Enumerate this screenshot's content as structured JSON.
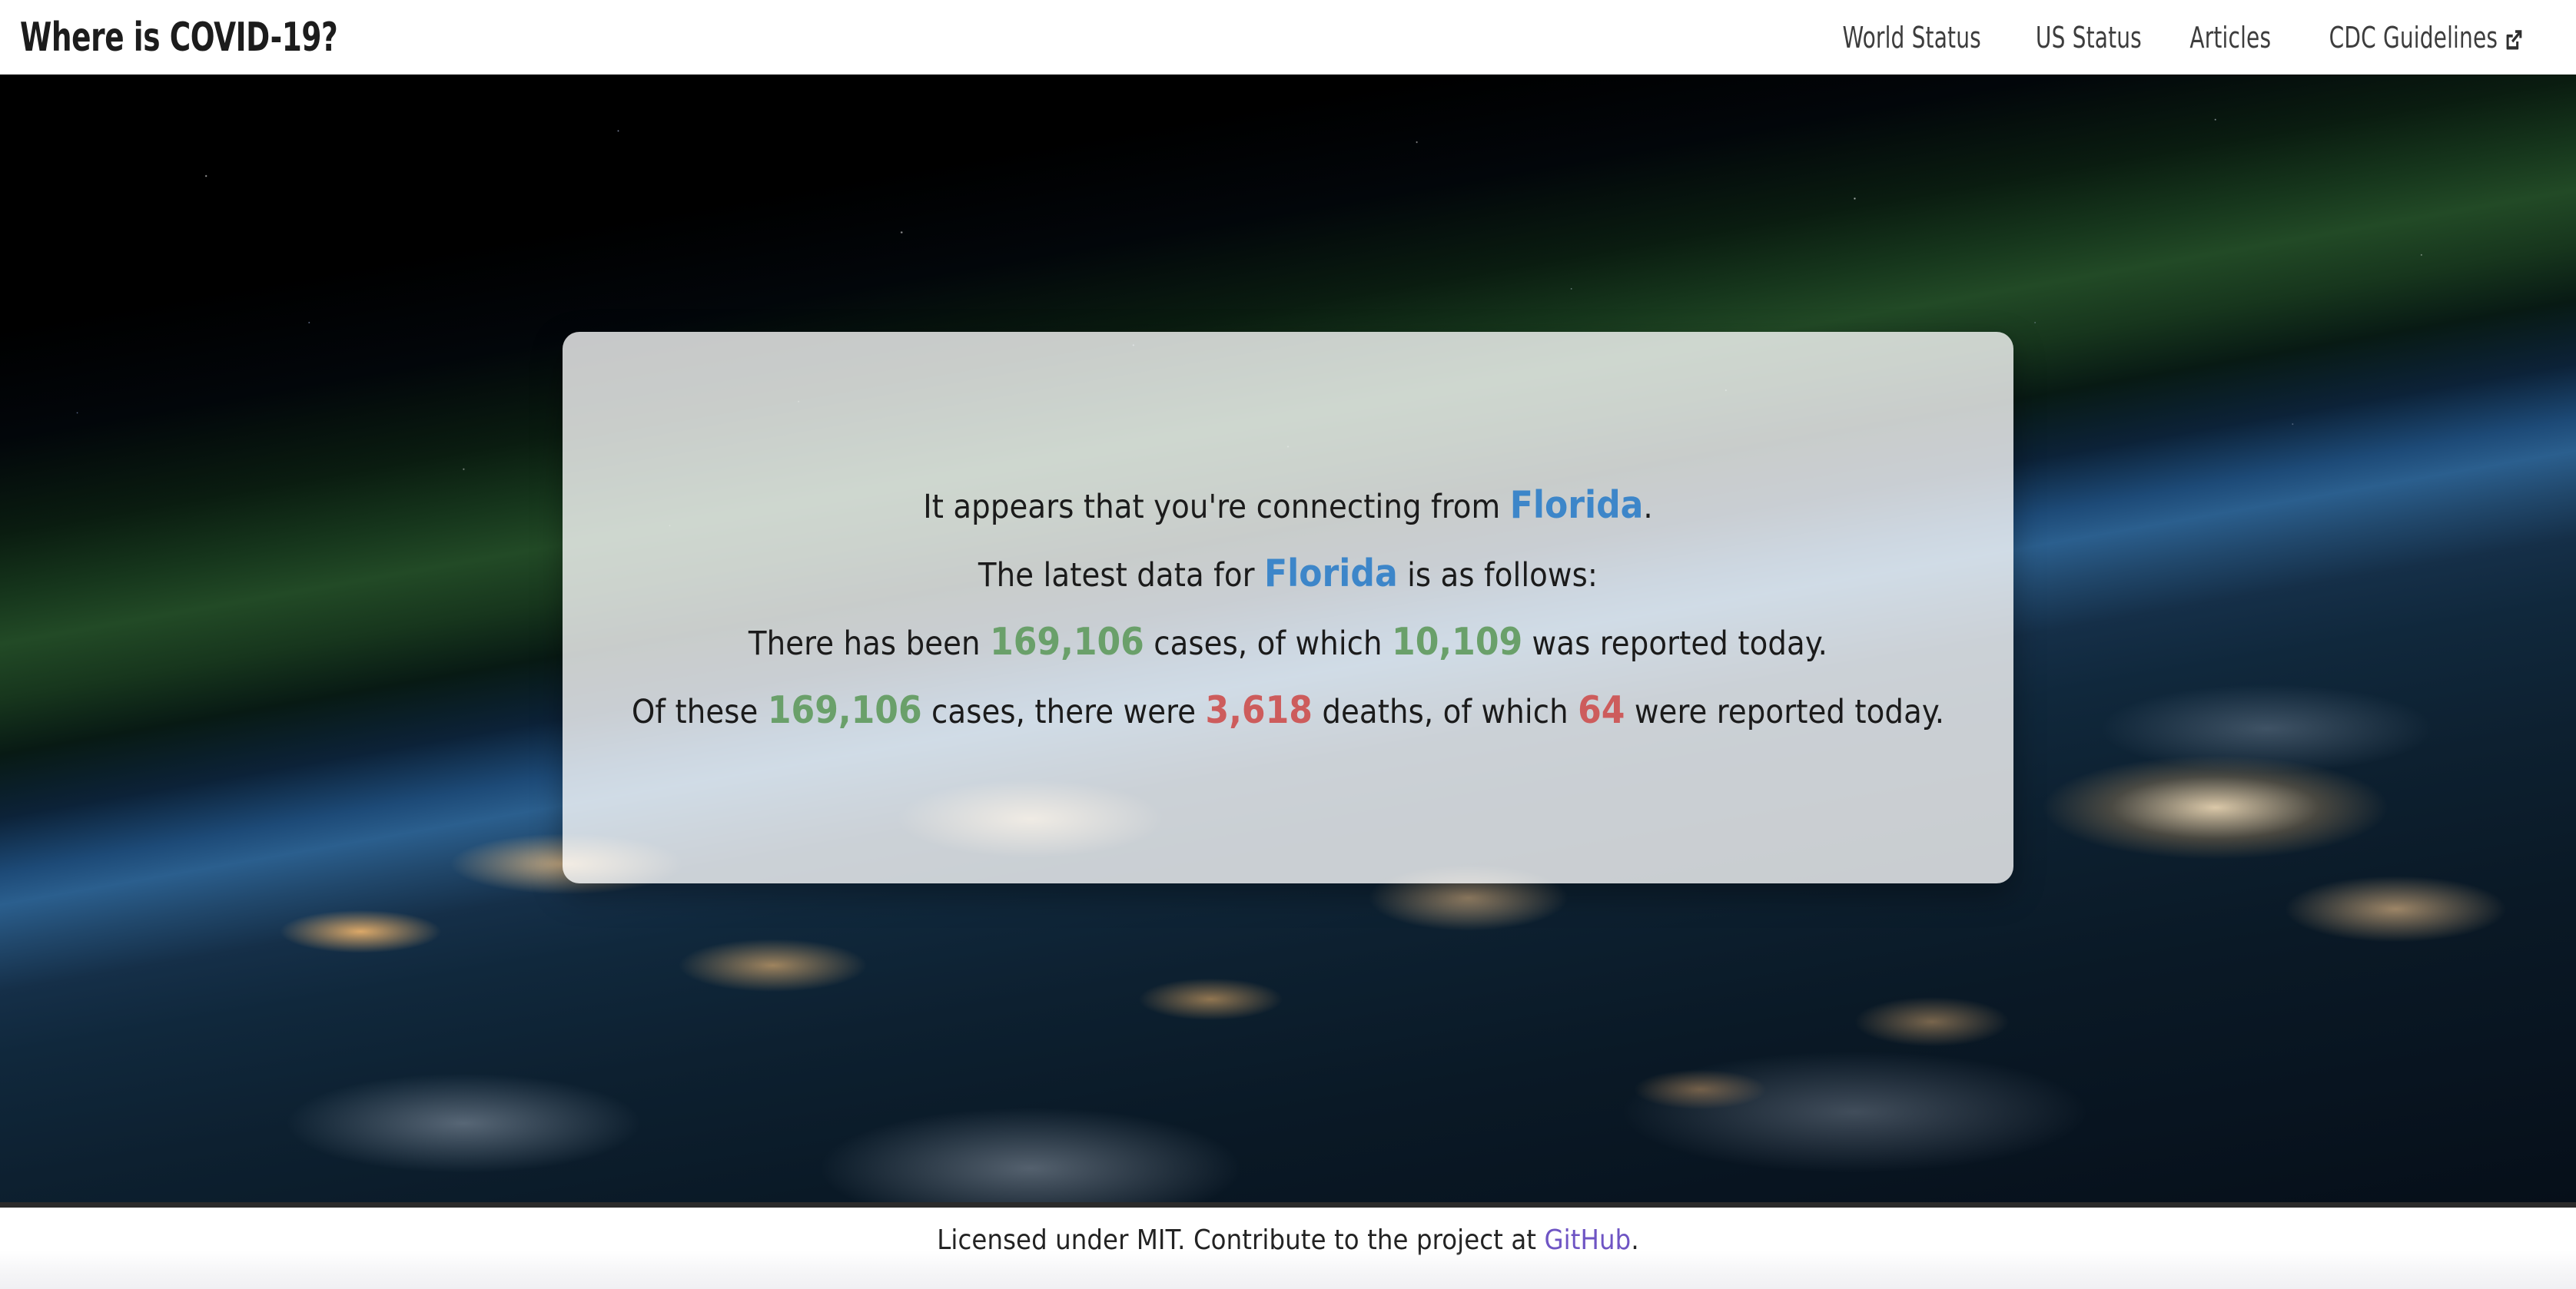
{
  "navbar": {
    "brand": "Where is COVID-19?",
    "links": [
      {
        "label": "World Status",
        "icon": null
      },
      {
        "label": "US Status",
        "icon": null
      },
      {
        "label": "Articles",
        "icon": null
      },
      {
        "label": "CDC Guidelines",
        "icon": "external-link-icon"
      }
    ]
  },
  "hero": {
    "background_image": "earth-from-space-night-city-lights",
    "card": {
      "line1": {
        "prefix": "It appears that you're connecting from ",
        "location": "Florida",
        "suffix": "."
      },
      "line2": {
        "prefix": "The latest data for ",
        "location": "Florida",
        "suffix": " is as follows:"
      },
      "line3": {
        "prefix": "There has been ",
        "cases": "169,106",
        "middle": " cases, of which ",
        "new_cases": "10,109",
        "suffix": " was reported today."
      },
      "line4": {
        "prefix": "Of these ",
        "cases": "169,106",
        "middle": " cases, there were ",
        "deaths": "3,618",
        "middle2": " deaths, of which ",
        "new_deaths": "64",
        "suffix": " were reported today."
      }
    }
  },
  "footer": {
    "prefix": "Licensed under MIT. Contribute to the project at ",
    "link": "GitHub",
    "suffix": "."
  },
  "colors": {
    "location": "#3d86c9",
    "cases": "#6aa06a",
    "deaths": "#cd5c5c",
    "footer_link": "#6f55c4",
    "navbar_bg": "#ffffff",
    "card_bg": "rgba(255,255,255,0.78)"
  }
}
